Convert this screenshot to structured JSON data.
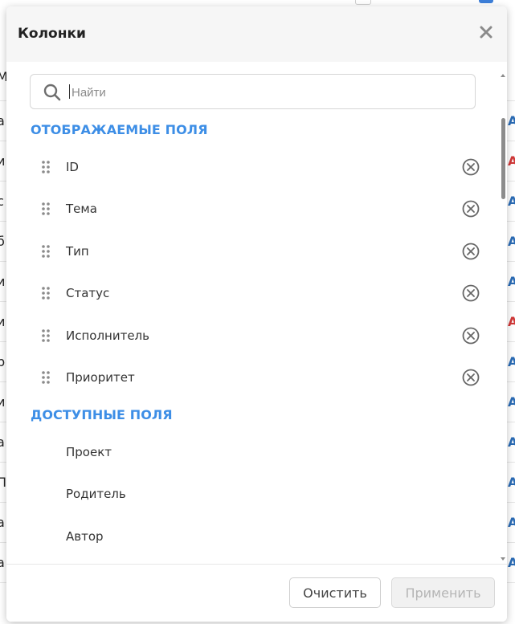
{
  "dialog": {
    "title": "Колонки",
    "close_icon": "close-icon"
  },
  "search": {
    "placeholder": "Найти",
    "value": ""
  },
  "sections": {
    "displayed_title": "ОТОБРАЖАЕМЫЕ ПОЛЯ",
    "available_title": "ДОСТУПНЫЕ ПОЛЯ"
  },
  "displayed_fields": [
    {
      "label": "ID"
    },
    {
      "label": "Тема"
    },
    {
      "label": "Тип"
    },
    {
      "label": "Статус"
    },
    {
      "label": "Исполнитель"
    },
    {
      "label": "Приоритет"
    }
  ],
  "available_fields": [
    {
      "label": "Проект"
    },
    {
      "label": "Родитель"
    },
    {
      "label": "Автор"
    }
  ],
  "footer": {
    "clear_label": "Очистить",
    "apply_label": "Применить"
  },
  "background": {
    "left_chars": [
      "М",
      "а",
      "и",
      "с",
      "б",
      "и",
      "и",
      "р",
      "и",
      "а",
      "П",
      "а",
      "а"
    ],
    "right_chars": [
      "A",
      "A",
      "A",
      "A",
      "A",
      "A",
      "A",
      "A",
      "A",
      "A",
      "A",
      "A"
    ],
    "right_colors": [
      "#2a6bb5",
      "#d13838",
      "#2a6bb5",
      "#2a6bb5",
      "#2a6bb5",
      "#d13838",
      "#2a6bb5",
      "#2a6bb5",
      "#2a6bb5",
      "#2a6bb5",
      "#2a6bb5",
      "#2a6bb5"
    ]
  },
  "colors": {
    "accent": "#3d8ee6",
    "header_bg": "#f6f6f6"
  }
}
